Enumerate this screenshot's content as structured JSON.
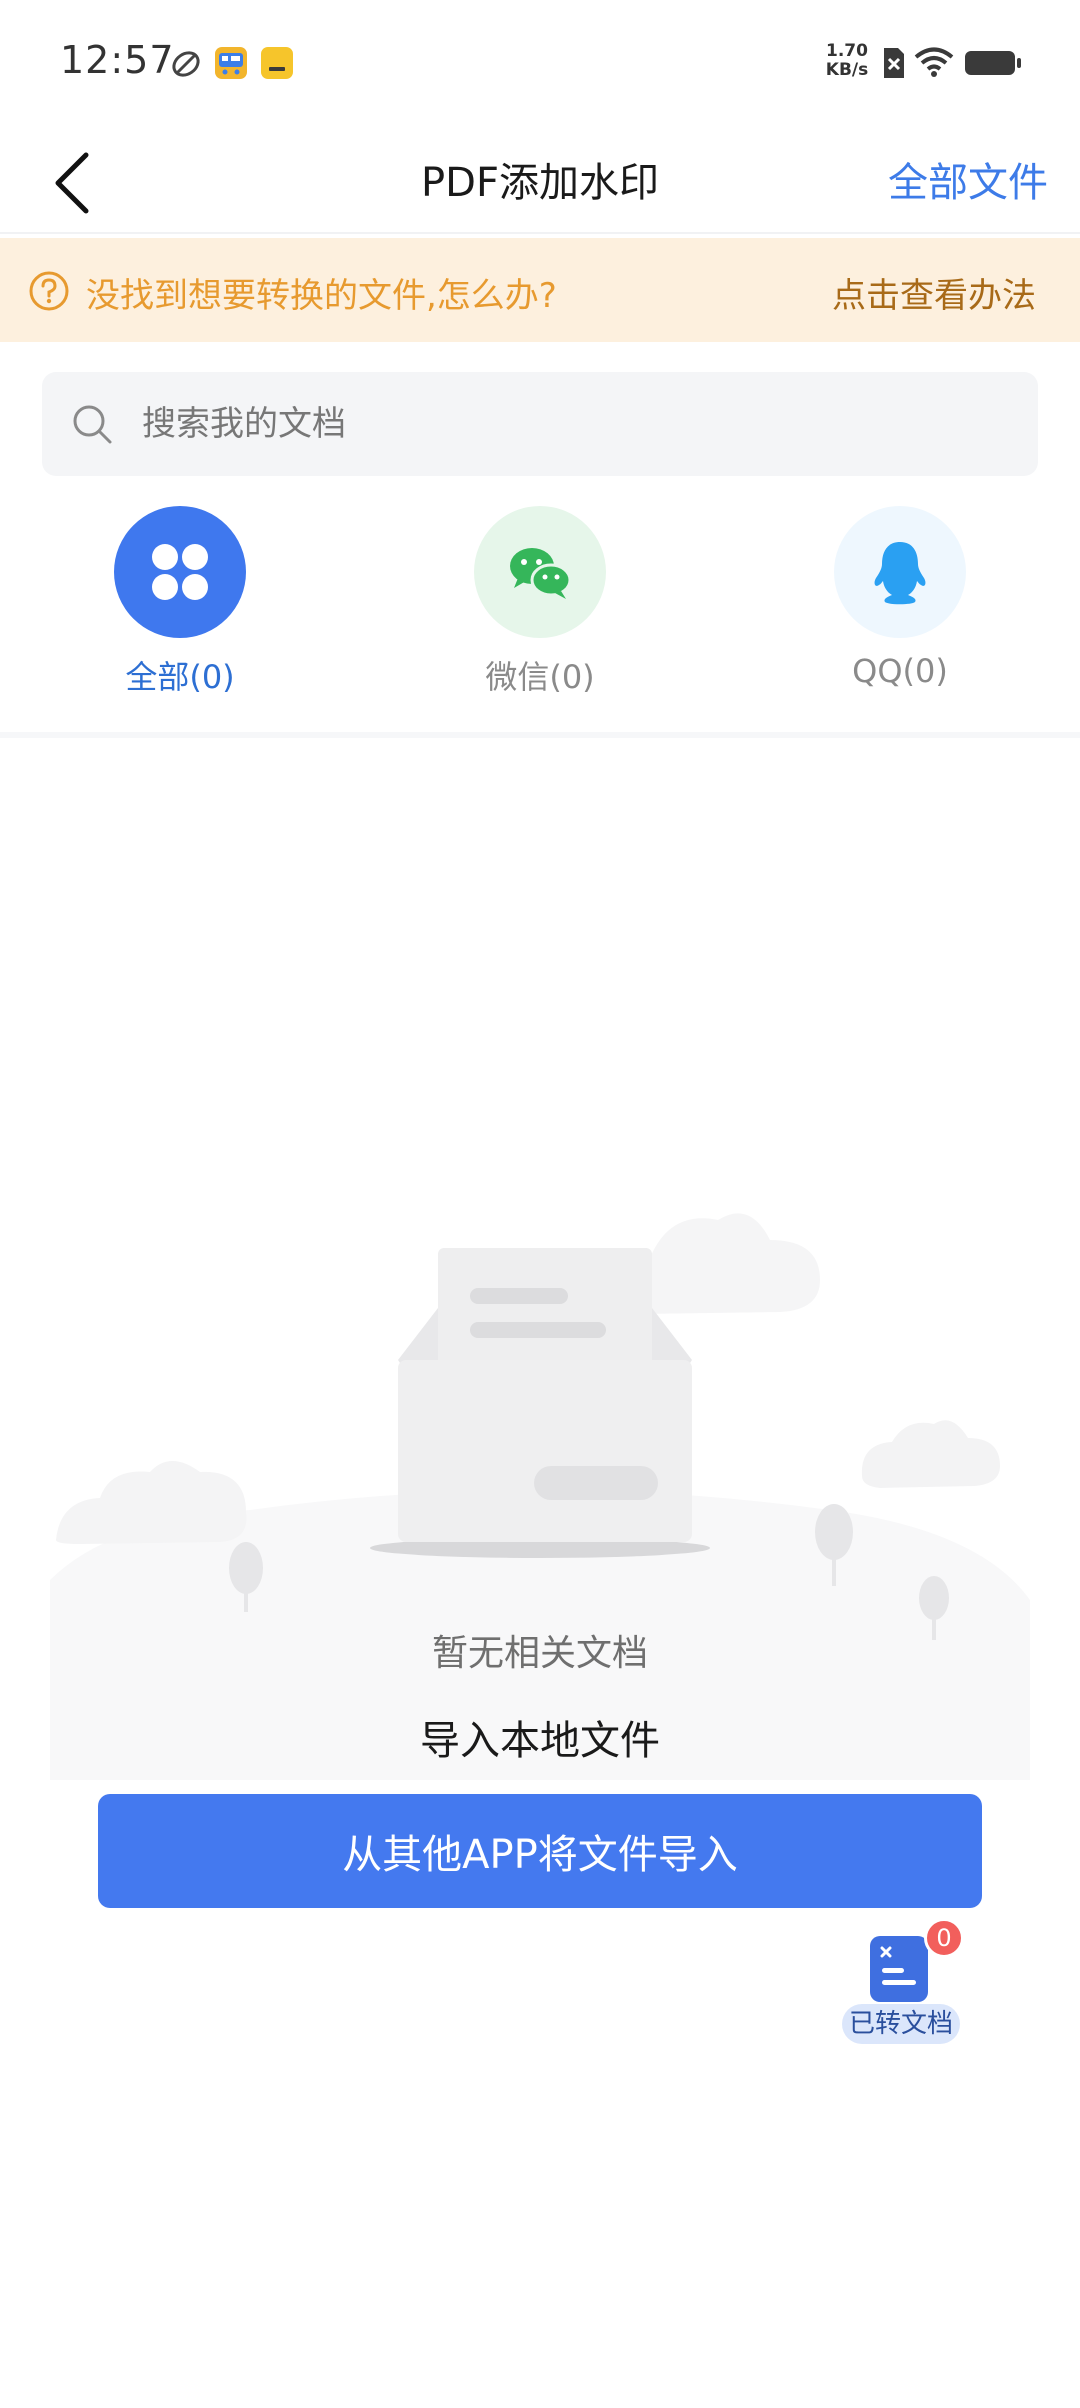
{
  "status_bar": {
    "time": "12:57",
    "net_speed_value": "1.70",
    "net_speed_unit": "KB/s"
  },
  "header": {
    "title": "PDF添加水印",
    "right_action": "全部文件"
  },
  "banner": {
    "text": "没找到想要转换的文件,怎么办?",
    "link": "点击查看办法"
  },
  "search": {
    "placeholder": "搜索我的文档"
  },
  "categories": [
    {
      "label": "全部(0)",
      "icon": "grid-icon",
      "active": true
    },
    {
      "label": "微信(0)",
      "icon": "wechat-icon",
      "active": false
    },
    {
      "label": "QQ(0)",
      "icon": "qq-icon",
      "active": false
    }
  ],
  "empty_state": {
    "message": "暂无相关文档",
    "import_local": "导入本地文件",
    "import_button": "从其他APP将文件导入"
  },
  "floating": {
    "label": "已转文档",
    "badge": "0"
  },
  "colors": {
    "accent": "#4479ef",
    "link_blue": "#3d7be8",
    "banner_bg": "#fdf0de",
    "banner_text": "#e79a2f",
    "wechat_green": "#35b65a",
    "qq_blue": "#2aa0f2"
  }
}
